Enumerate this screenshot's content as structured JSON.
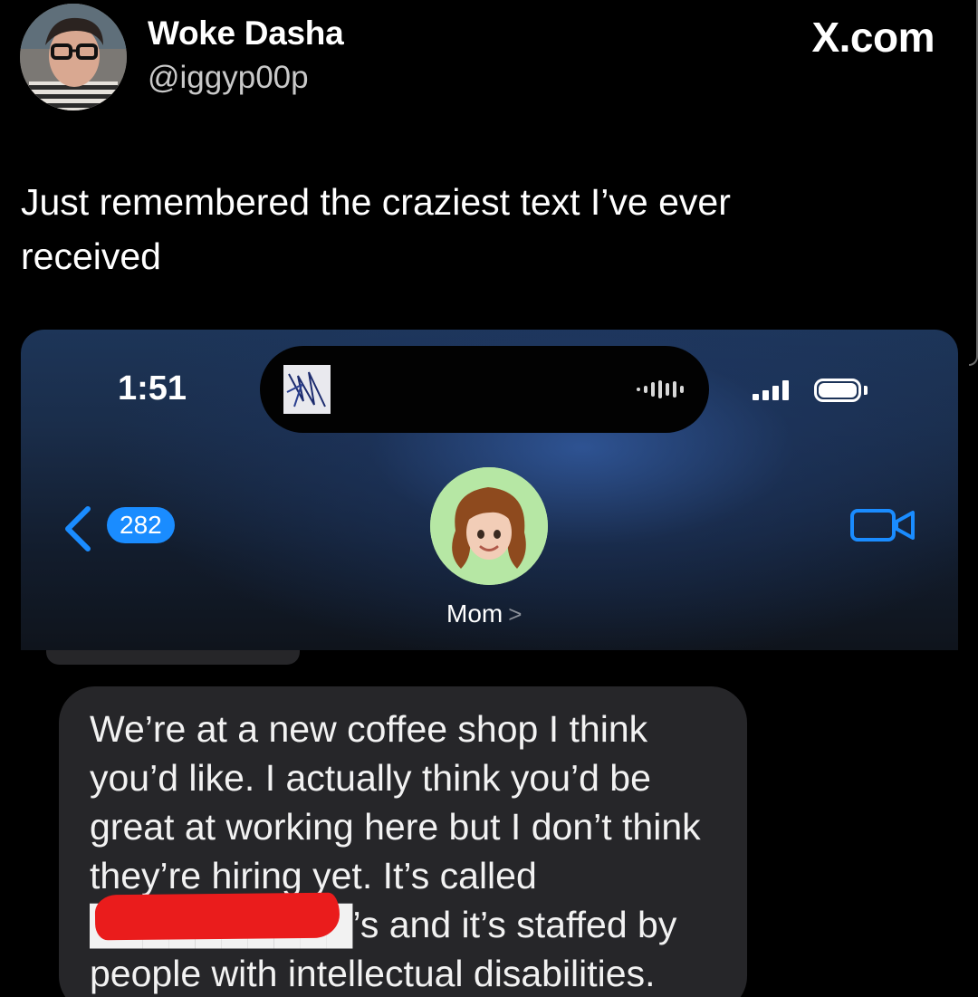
{
  "tweet": {
    "display_name": "Woke Dasha",
    "handle": "@iggyp00p",
    "site": "X.com",
    "text": "Just remembered the craziest text I’ve ever received"
  },
  "phone": {
    "status_bar": {
      "time": "1:51"
    },
    "conversation": {
      "unread_count": "282",
      "contact_name": "Mom",
      "contact_chevron": ">"
    },
    "message": {
      "text": "We’re at a new coffee shop I think you’d like. I actually think you’d be great at working here but I don’t think they’re hiring yet. It’s called ██████████’s and it’s staffed by people with intellectual disabilities."
    }
  },
  "colors": {
    "background": "#000000",
    "accent_blue": "#1a8cff",
    "bubble": "#262629",
    "redaction": "#ea1c1c",
    "contact_avatar_bg": "#b6e7a4"
  },
  "icons": {
    "back": "chevron-left-icon",
    "video": "video-camera-icon",
    "signal": "cellular-signal-icon",
    "battery": "battery-icon",
    "waveform": "audio-waveform-icon"
  }
}
